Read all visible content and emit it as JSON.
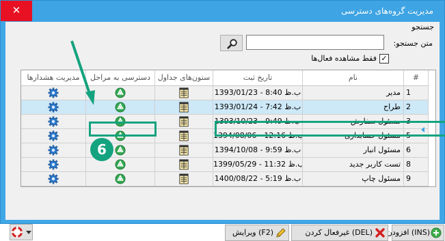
{
  "window": {
    "title": "مدیریت گروه‌های دسترسی",
    "close_symbol": "✕"
  },
  "search": {
    "group_label": "جستجو",
    "text_label": "متن جستجو:",
    "input_value": "",
    "button_icon": "search-icon",
    "active_only_label": "فقط مشاهده فعال‌ها",
    "active_only_checked": true,
    "check_mark": "✓"
  },
  "grid": {
    "headers": {
      "num": "#",
      "name": "نام",
      "date": "تاریخ ثبت",
      "tables": "ستون‌های جداول",
      "steps": "دسترسی به مراحل",
      "alerts": "مدیریت هشدارها"
    },
    "rows": [
      {
        "num": "1",
        "name": "مدیر",
        "date": "1393/01/23 - 8:40 ب.ظ",
        "selected": false
      },
      {
        "num": "2",
        "name": "طراح",
        "date": "1393/01/24 - 7:42 ب.ظ",
        "selected": true
      },
      {
        "num": "3",
        "name": "مسئول سفارش",
        "date": "1393/10/23 - 9:49 ب.ظ",
        "selected": false
      },
      {
        "num": "5",
        "name": "مسئول حسابداری",
        "date": "1394/08/06 - 12:16 ب.ظ",
        "selected": false
      },
      {
        "num": "6",
        "name": "مسئول انبار",
        "date": "1394/10/08 - 9:59 ب.ظ",
        "selected": false
      },
      {
        "num": "8",
        "name": "تست کاربر جدید",
        "date": "1399/05/29 - 11:32 ب.ظ",
        "selected": false
      },
      {
        "num": "9",
        "name": "مسئول چاپ",
        "date": "1400/08/22 - 5:19 ب.ظ",
        "selected": false
      }
    ],
    "icons": {
      "tables": "table-columns-icon",
      "steps": "green-circle-arrows-icon",
      "alerts": "gear-icon"
    }
  },
  "annotation": {
    "badge": "6",
    "color": "#14a37f"
  },
  "buttons": {
    "add": "(INS) افزودن",
    "deactivate": "(DEL) غیرفعال کردن",
    "edit": "(F2) ویرایش"
  },
  "colors": {
    "title_bar": "#3ea4e3",
    "close": "#e81123",
    "selection": "#cde8f7",
    "highlight": "#14a37f"
  }
}
